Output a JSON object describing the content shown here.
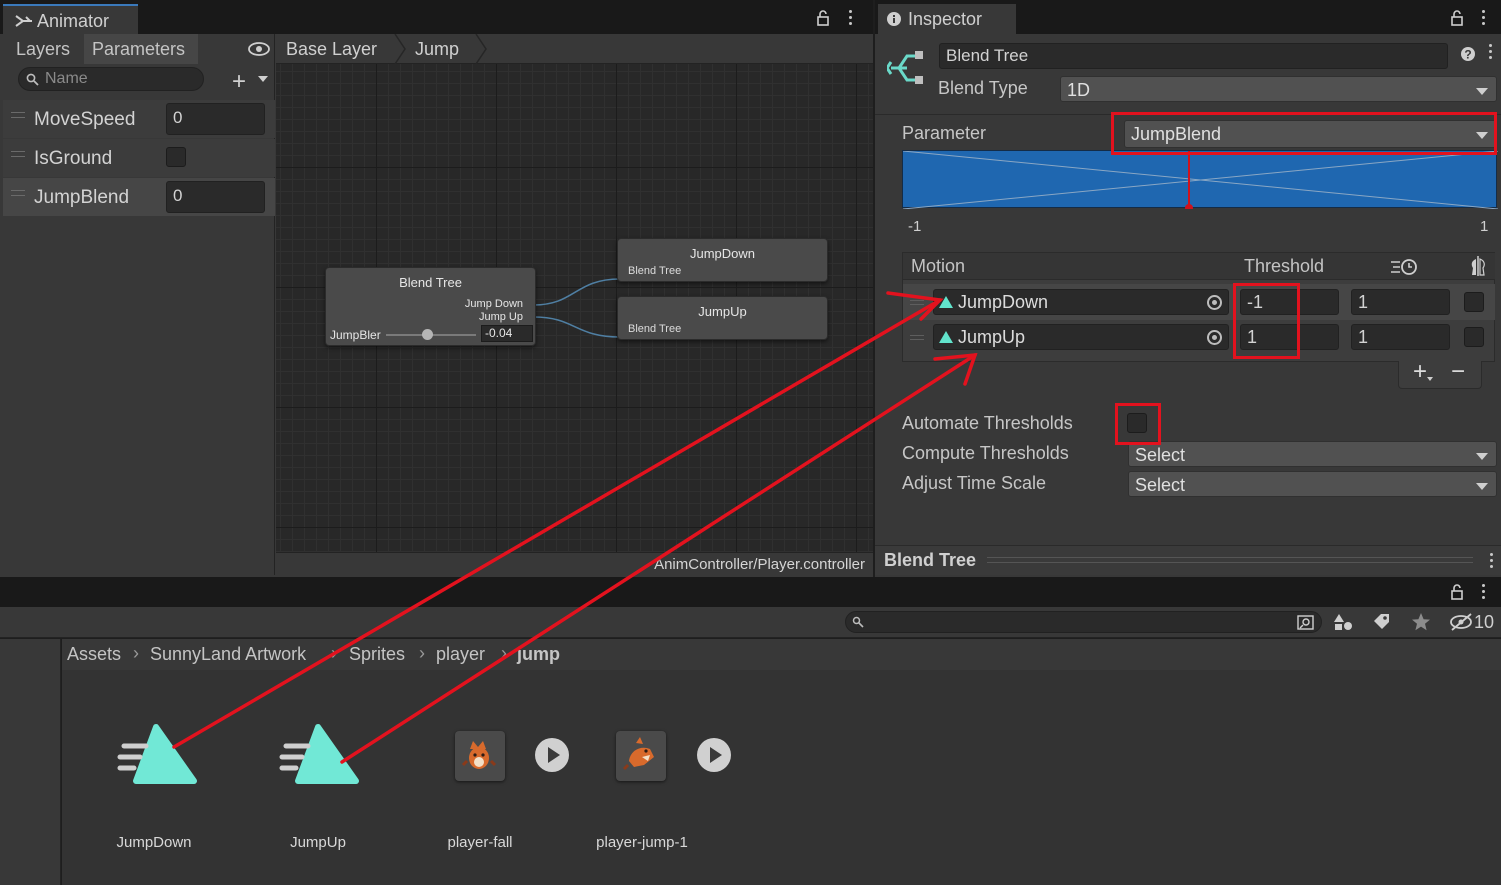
{
  "colors": {
    "annotation": "#e3121e",
    "blend_fill": "#1f67b0",
    "motion_icon": "#62e3cc",
    "tab_accent": "#3a79bb"
  },
  "animator": {
    "title": "Animator",
    "tabs": [
      "Layers",
      "Parameters"
    ],
    "active_tab": "Parameters",
    "search_placeholder": "Name",
    "parameters": [
      {
        "name": "MoveSpeed",
        "type": "float",
        "value": "0"
      },
      {
        "name": "IsGround",
        "type": "bool",
        "value": false
      },
      {
        "name": "JumpBlend",
        "type": "float",
        "value": "0"
      }
    ],
    "breadcrumbs": [
      "Base Layer",
      "Jump"
    ],
    "nodes": {
      "blend_tree": {
        "title": "Blend Tree",
        "outputs": [
          "Jump Down",
          "Jump Up"
        ],
        "param_label": "JumpBler",
        "param_value": "-0.04"
      },
      "jump_down": {
        "title": "JumpDown",
        "subtitle": "Blend Tree"
      },
      "jump_up": {
        "title": "JumpUp",
        "subtitle": "Blend Tree"
      }
    },
    "footer_path": "AnimController/Player.controller"
  },
  "inspector": {
    "title": "Inspector",
    "name_value": "Blend Tree",
    "blend_type_label": "Blend Type",
    "blend_type_value": "1D",
    "parameter_label": "Parameter",
    "parameter_value": "JumpBlend",
    "range_min": "-1",
    "range_max": "1",
    "motion_header": "Motion",
    "threshold_header": "Threshold",
    "motions": [
      {
        "name": "JumpDown",
        "threshold": "-1",
        "speed": "1",
        "mirror": false
      },
      {
        "name": "JumpUp",
        "threshold": "1",
        "speed": "1",
        "mirror": false
      }
    ],
    "automate_thresholds_label": "Automate Thresholds",
    "automate_thresholds": false,
    "compute_thresholds_label": "Compute Thresholds",
    "compute_thresholds_value": "Select",
    "adjust_time_scale_label": "Adjust Time Scale",
    "adjust_time_scale_value": "Select",
    "footer_title": "Blend Tree",
    "plus_label": "+",
    "minus_label": "−"
  },
  "project": {
    "hidden_count": "10",
    "breadcrumbs": [
      "Assets",
      "SunnyLand Artwork",
      "Sprites",
      "player",
      "jump"
    ],
    "assets": [
      {
        "name": "JumpDown",
        "kind": "animation-clip"
      },
      {
        "name": "JumpUp",
        "kind": "animation-clip"
      },
      {
        "name": "player-fall",
        "kind": "sprite"
      },
      {
        "name": "player-jump-1",
        "kind": "sprite"
      }
    ]
  }
}
